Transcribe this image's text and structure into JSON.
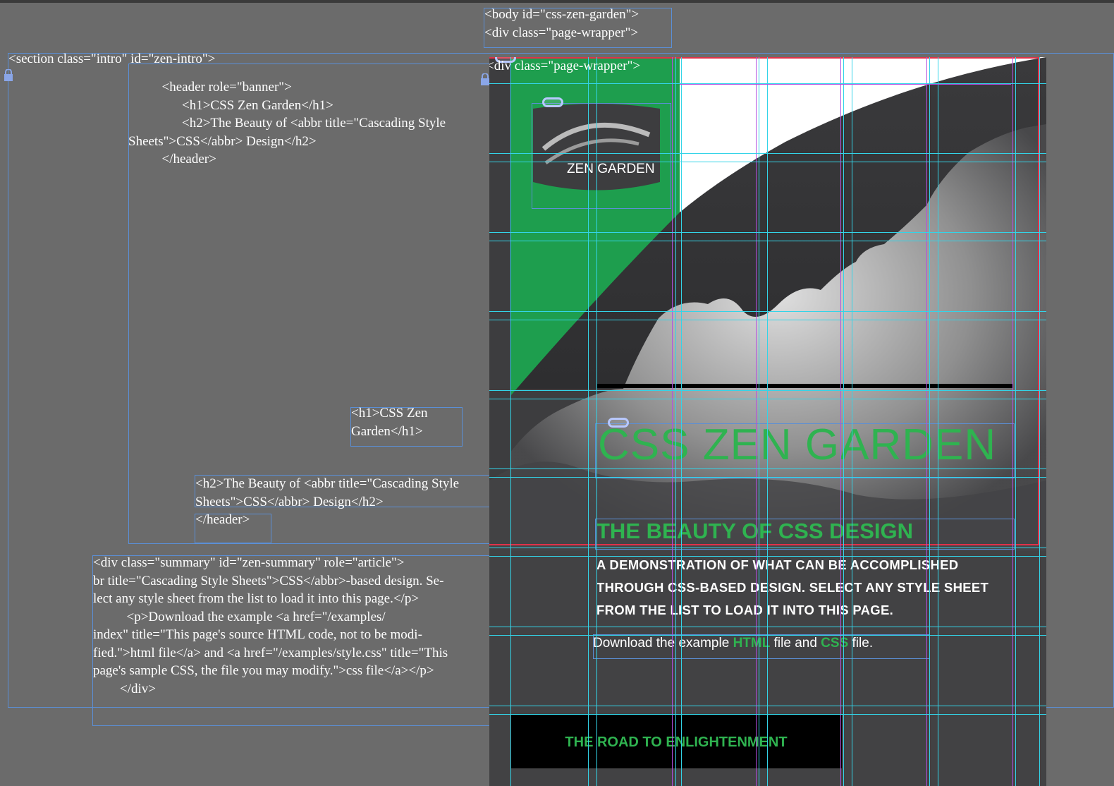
{
  "code_frames": {
    "body_wrapper": "<body id=\"css-zen-garden\">\n<div class=\"page-wrapper\">",
    "intro_section": "<section class=\"intro\" id=\"zen-intro\">",
    "header_block": "          <header role=\"banner\">\n                <h1>CSS Zen Garden</h1>\n                <h2>The Beauty of <abbr title=\"Cascading Style\nSheets\">CSS</abbr> Design</h2>\n          </header>",
    "h1_block": "<h1>CSS Zen\nGarden</h1>",
    "h2_block": "<h2>The Beauty of <abbr title=\"Cascading Style\nSheets\">CSS</abbr> Design</h2>",
    "header_close": "</header>",
    "summary_block": "<div class=\"summary\" id=\"zen-summary\" role=\"article\">\nbr title=\"Cascading Style Sheets\">CSS</abbr>-based design. Se-\nlect any style sheet from the list to load it into this page.</p>\n          <p>Download the example <a href=\"/examples/\nindex\" title=\"This page's source HTML code, not to be modi-\nfied.\">html file</a> and <a href=\"/examples/style.css\" title=\"This\npage's sample CSS, the file you may modify.\">css file</a></p>\n        </div>",
    "page_wrapper_label": "<div class=\"page-wrapper\">"
  },
  "page": {
    "logo_text": "ZEN GARDEN",
    "title": "CSS ZEN GARDEN",
    "subtitle": "THE BEAUTY OF CSS DESIGN",
    "summary": "A DEMONSTRATION OF WHAT CAN BE ACCOMPLISHED THROUGH CSS-BASED DESIGN.  SELECT ANY STYLE SHEET FROM THE LIST TO LOAD IT INTO THIS PAGE.",
    "download_prefix": "Download the example ",
    "download_html": "HTML",
    "download_mid": " file and ",
    "download_css": "CSS",
    "download_suffix": " file.",
    "road_heading": "THE ROAD TO ENLIGHTENMENT"
  },
  "colors": {
    "accent_green": "#2fb350",
    "canvas_gray": "#6b6b6b",
    "frame_blue": "#5b8fd6",
    "guide_cyan": "#33d4e8",
    "guide_magenta": "#b34fe0",
    "selection_red": "#e0324a"
  },
  "icons": {
    "link": "chain-link-icon",
    "lock": "padlock-icon"
  }
}
